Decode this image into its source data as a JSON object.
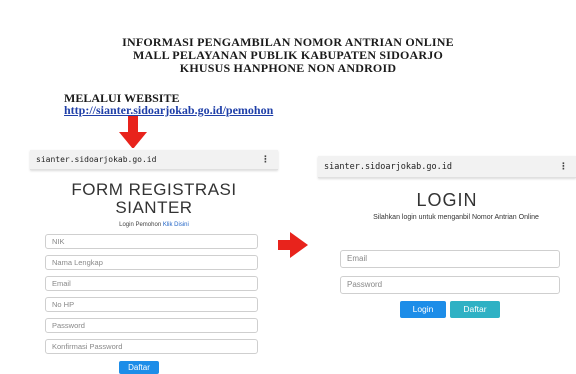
{
  "heading": {
    "line1": "INFORMASI PENGAMBILAN NOMOR ANTRIAN ONLINE",
    "line2": "MALL PELAYANAN PUBLIK KABUPATEN SIDOARJO",
    "line3": "KHUSUS HANPHONE NON ANDROID"
  },
  "via_label": "MELALUI WEBSITE",
  "website_url": "http://sianter.sidoarjokab.go.id/pemohon",
  "colors": {
    "arrow": "#e8231c",
    "link": "#1f3fa8",
    "primary_button": "#1d8de8",
    "secondary_button": "#2fb1c4"
  },
  "register_screen": {
    "address_bar": "sianter.sidoarjokab.go.id",
    "menu_icon": "more-vertical-icon",
    "title_line1": "FORM REGISTRASI",
    "title_line2": "SIANTER",
    "login_prompt": "Login Pemohon",
    "login_link": "Klik Disini",
    "fields": {
      "nik": "NIK",
      "nama": "Nama Lengkap",
      "email": "Email",
      "hp": "No HP",
      "password": "Password",
      "konfirmasi": "Konfirmasi Password"
    },
    "submit_button": "Daftar"
  },
  "login_screen": {
    "address_bar": "sianter.sidoarjokab.go.id",
    "menu_icon": "more-vertical-icon",
    "title": "LOGIN",
    "subtitle": "Silahkan login untuk menganbil Nomor Antrian Online",
    "fields": {
      "email": "Email",
      "password": "Password"
    },
    "login_button": "Login",
    "register_button": "Daftar"
  }
}
